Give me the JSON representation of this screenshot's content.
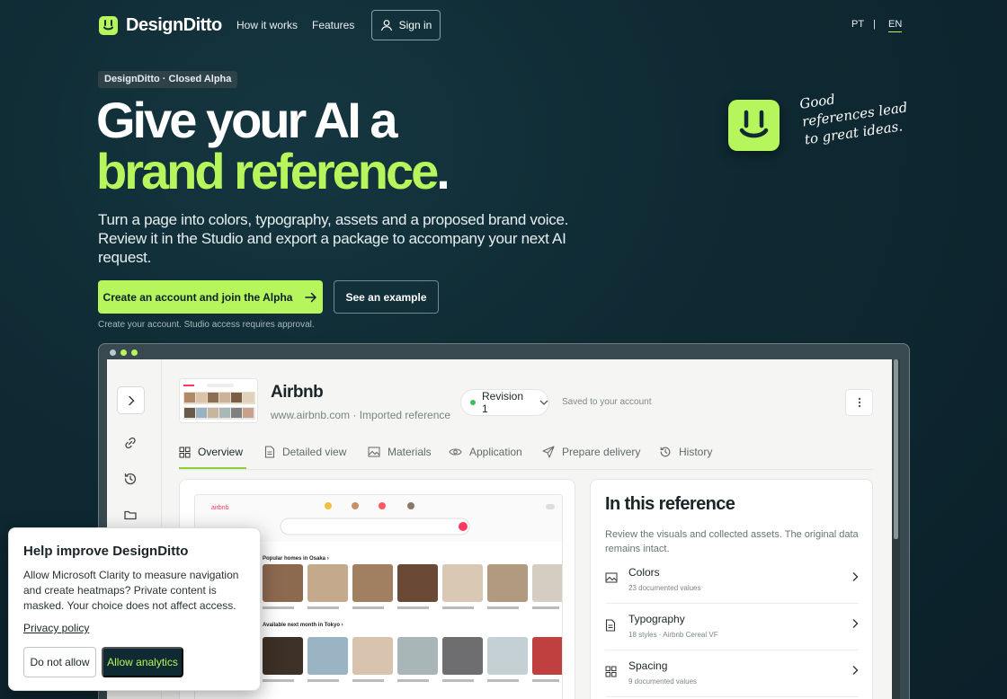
{
  "brand": {
    "name": "DesignDitto",
    "accent": "#b6f55b",
    "background": "#0f2a33"
  },
  "nav": {
    "links": [
      "How it works",
      "Features"
    ],
    "signin_label": "Sign in",
    "languages": [
      "PT",
      "|",
      "EN"
    ],
    "active_language": "EN"
  },
  "hero": {
    "badge": "DesignDitto · Closed Alpha",
    "headline_line1": "Give your AI a",
    "headline_line2": "brand reference",
    "headline_dot": ".",
    "lead": "Turn a page into colors, typography, assets and a proposed brand voice. Review it in the Studio and export a package to accompany your next AI request.",
    "cta_primary": "Create an account and join the Alpha",
    "cta_secondary": "See an example",
    "note": "Create your account. Studio access requires approval.",
    "handnote": "Good references lead to great ideas."
  },
  "studio": {
    "reference_title": "Airbnb",
    "reference_url": "www.airbnb.com · Imported reference",
    "revision": "Revision 1",
    "saved": "Saved to your account",
    "tabs": [
      {
        "label": "Overview",
        "icon": "grid-icon"
      },
      {
        "label": "Detailed view",
        "icon": "document-icon"
      },
      {
        "label": "Materials",
        "icon": "image-icon"
      },
      {
        "label": "Application",
        "icon": "eye-icon"
      },
      {
        "label": "Prepare delivery",
        "icon": "send-icon"
      },
      {
        "label": "History",
        "icon": "history-icon"
      }
    ],
    "sidebar_icons": [
      "chevron-right-icon",
      "link-icon",
      "history-icon",
      "folder-icon"
    ],
    "preview_snippets": {
      "logo": "airbnb",
      "section1": "Popular homes in Osaka ›",
      "section2": "Available next month in Tokyo ›"
    },
    "info": {
      "title": "In this reference",
      "description": "Review the visuals and collected assets. The original data remains intact.",
      "rows": [
        {
          "name": "Colors",
          "sub": "23 documented values",
          "icon": "image-icon"
        },
        {
          "name": "Typography",
          "sub": "18 styles · Airbnb Cereal VF",
          "icon": "document-icon"
        },
        {
          "name": "Spacing",
          "sub": "9 documented values",
          "icon": "grid-icon"
        }
      ]
    }
  },
  "consent": {
    "title": "Help improve DesignDitto",
    "body": "Allow Microsoft Clarity to measure navigation and create heatmaps? Private content is masked. Your choice does not affect access.",
    "privacy_link": "Privacy policy",
    "deny": "Do not allow",
    "allow": "Allow analytics"
  }
}
